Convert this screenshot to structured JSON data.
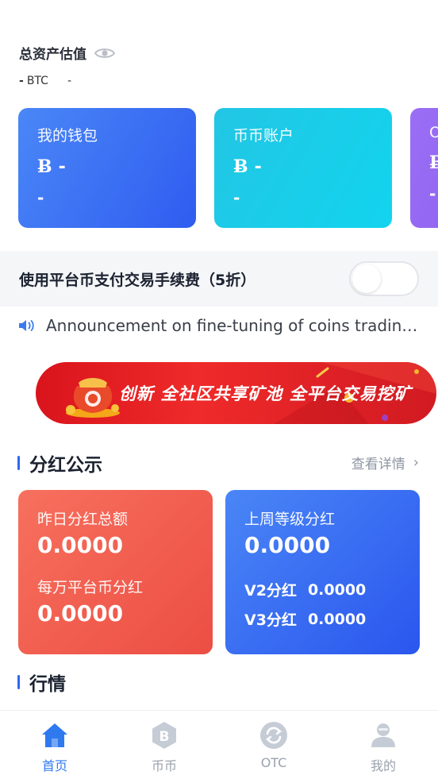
{
  "assets": {
    "title": "总资产估值",
    "btc_prefix": "-",
    "btc_unit": "BTC",
    "fiat_value": "-"
  },
  "wallets": [
    {
      "name": "我的钱包",
      "symbol": "Ƀ",
      "amount": "-",
      "sub": "-"
    },
    {
      "name": "币币账户",
      "symbol": "Ƀ",
      "amount": "-",
      "sub": "-"
    },
    {
      "name": "O",
      "symbol": "Ƀ",
      "amount": "",
      "sub": "-"
    }
  ],
  "fee": {
    "label": "使用平台币支付交易手续费（5折）",
    "enabled": false
  },
  "announcement": {
    "text": "Announcement on fine-tuning of coins trading pl..."
  },
  "banner": {
    "text": "创新 全社区共享矿池 全平台交易挖矿"
  },
  "dividend": {
    "title": "分红公示",
    "more": "查看详情",
    "left": {
      "yesterday_label": "昨日分红总额",
      "yesterday_value": "0.0000",
      "per_label": "每万平台币分红",
      "per_value": "0.0000"
    },
    "right": {
      "week_label": "上周等级分红",
      "week_value": "0.0000",
      "v2_label": "V2分红",
      "v2_value": "0.0000",
      "v3_label": "V3分红",
      "v3_value": "0.0000"
    }
  },
  "market": {
    "title": "行情"
  },
  "nav": {
    "items": [
      {
        "label": "首页",
        "icon": "home-icon",
        "active": true
      },
      {
        "label": "币币",
        "icon": "bitcoin-icon",
        "active": false
      },
      {
        "label": "OTC",
        "icon": "exchange-icon",
        "active": false
      },
      {
        "label": "我的",
        "icon": "user-icon",
        "active": false
      }
    ]
  },
  "colors": {
    "accent": "#2f79ef",
    "wallet_blue": "#3b6ff4",
    "wallet_cyan": "#17cde9",
    "wallet_purple": "#9468f4",
    "dividend_red": "#f0594b",
    "dividend_blue": "#3567f1",
    "banner_red": "#e11d24"
  }
}
